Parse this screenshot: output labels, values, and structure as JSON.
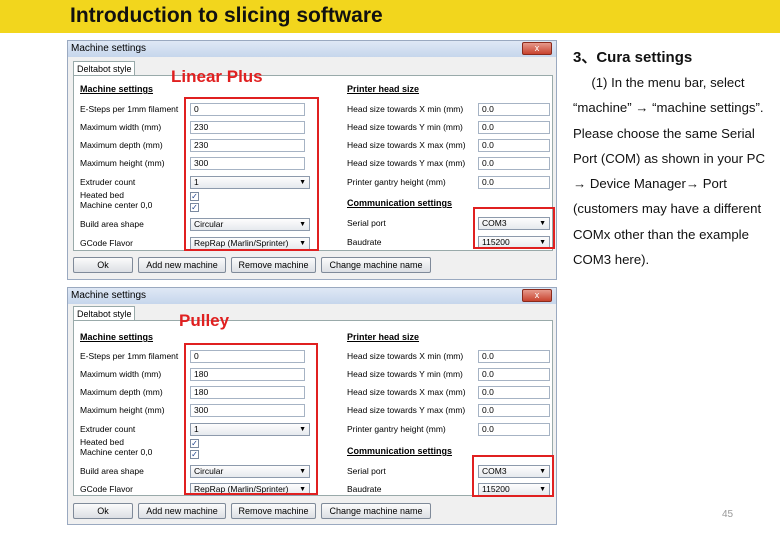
{
  "banner": {
    "title": "Introduction to slicing software"
  },
  "common": {
    "window_title": "Machine settings",
    "close_glyph": "x",
    "tab_label": "Deltabot style",
    "labels": {
      "machine_settings": "Machine settings",
      "e_steps": "E-Steps per 1mm filament",
      "max_width": "Maximum width (mm)",
      "max_depth": "Maximum depth (mm)",
      "max_height": "Maximum height (mm)",
      "extruder_count": "Extruder count",
      "heated_bed": "Heated bed",
      "machine_center": "Machine center 0,0",
      "build_area_shape": "Build area shape",
      "gcode_flavor": "GCode Flavor",
      "printer_head_size": "Printer head size",
      "head_x_min": "Head size towards X min (mm)",
      "head_y_min": "Head size towards Y min (mm)",
      "head_x_max": "Head size towards X max (mm)",
      "head_y_max": "Head size towards Y max (mm)",
      "gantry_height": "Printer gantry height (mm)",
      "communication_settings": "Communication settings",
      "serial_port": "Serial port",
      "baudrate": "Baudrate"
    },
    "buttons": {
      "ok": "Ok",
      "add": "Add new machine",
      "remove": "Remove machine",
      "change": "Change machine name"
    },
    "arrow_glyph": "▼",
    "check_glyph": "✓"
  },
  "windows": [
    {
      "tag": "Linear Plus",
      "values": {
        "e_steps": "0",
        "max_width": "230",
        "max_depth": "230",
        "max_height": "300",
        "extruder_count": "1",
        "heated_bed_checked": true,
        "machine_center_checked": true,
        "build_area_shape": "Circular",
        "gcode_flavor": "RepRap (Marlin/Sprinter)",
        "head_x_min": "0.0",
        "head_y_min": "0.0",
        "head_x_max": "0.0",
        "head_y_max": "0.0",
        "gantry_height": "0.0",
        "serial_port": "COM3",
        "baudrate": "115200"
      }
    },
    {
      "tag": "Pulley",
      "values": {
        "e_steps": "0",
        "max_width": "180",
        "max_depth": "180",
        "max_height": "300",
        "extruder_count": "1",
        "heated_bed_checked": true,
        "machine_center_checked": true,
        "build_area_shape": "Circular",
        "gcode_flavor": "RepRap (Marlin/Sprinter)",
        "head_x_min": "0.0",
        "head_y_min": "0.0",
        "head_x_max": "0.0",
        "head_y_max": "0.0",
        "gantry_height": "0.0",
        "serial_port": "COM3",
        "baudrate": "115200"
      }
    }
  ],
  "side": {
    "title": "3、Cura settings",
    "body": "     (1) In the menu bar, select “machine” → “machine settings”. Please choose the same Serial Port (COM) as shown in your PC → Device Manager→ Port (customers may have a different COMx other than the example COM3 here)."
  },
  "page_number": "45",
  "colors": {
    "banner": "#f2d61d",
    "highlight": "#e02020"
  }
}
